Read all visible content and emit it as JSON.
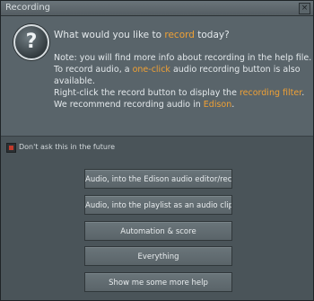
{
  "window": {
    "title": "Recording",
    "close_glyph": "×"
  },
  "message": {
    "question_prefix": "What would you like to ",
    "question_highlight": "record",
    "question_suffix": " today?",
    "note_line1": "Note: you will find more info about recording in the help file.",
    "note_line2_prefix": "To record audio, a ",
    "note_line2_highlight": "one-click",
    "note_line2_suffix": " audio recording button is also",
    "note_line3": "available.",
    "note_line4_prefix": "Right-click the record button to display the ",
    "note_line4_highlight": "recording filter",
    "note_line4_suffix": ".",
    "note_line5_prefix": "We recommend recording audio in ",
    "note_line5_highlight": "Edison",
    "note_line5_suffix": "."
  },
  "checkbox": {
    "label": "Don't ask this in the future",
    "checked": true
  },
  "buttons": [
    {
      "label": "Audio, into the Edison audio editor/recorder"
    },
    {
      "label": "Audio, into the playlist as an audio clip"
    },
    {
      "label": "Automation & score"
    },
    {
      "label": "Everything"
    },
    {
      "label": "Show me some more help"
    }
  ],
  "colors": {
    "highlight": "#f0a135",
    "background": "#4a5459",
    "panel": "#59646a"
  },
  "icons": {
    "help": "question-mark-icon"
  }
}
